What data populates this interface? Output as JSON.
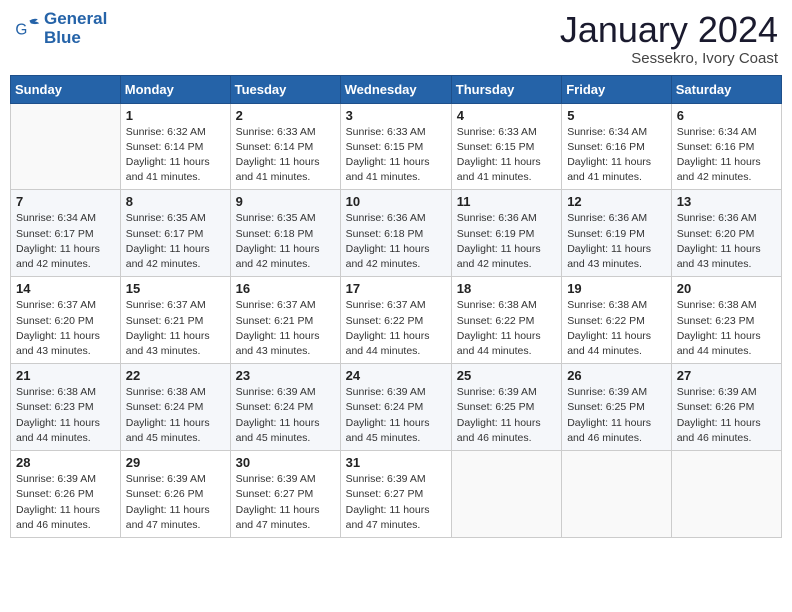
{
  "header": {
    "logo_text_general": "General",
    "logo_text_blue": "Blue",
    "month": "January 2024",
    "location": "Sessekro, Ivory Coast"
  },
  "weekdays": [
    "Sunday",
    "Monday",
    "Tuesday",
    "Wednesday",
    "Thursday",
    "Friday",
    "Saturday"
  ],
  "weeks": [
    [
      {
        "day": "",
        "sunrise": "",
        "sunset": "",
        "daylight": ""
      },
      {
        "day": "1",
        "sunrise": "6:32 AM",
        "sunset": "6:14 PM",
        "daylight": "11 hours and 41 minutes."
      },
      {
        "day": "2",
        "sunrise": "6:33 AM",
        "sunset": "6:14 PM",
        "daylight": "11 hours and 41 minutes."
      },
      {
        "day": "3",
        "sunrise": "6:33 AM",
        "sunset": "6:15 PM",
        "daylight": "11 hours and 41 minutes."
      },
      {
        "day": "4",
        "sunrise": "6:33 AM",
        "sunset": "6:15 PM",
        "daylight": "11 hours and 41 minutes."
      },
      {
        "day": "5",
        "sunrise": "6:34 AM",
        "sunset": "6:16 PM",
        "daylight": "11 hours and 41 minutes."
      },
      {
        "day": "6",
        "sunrise": "6:34 AM",
        "sunset": "6:16 PM",
        "daylight": "11 hours and 42 minutes."
      }
    ],
    [
      {
        "day": "7",
        "sunrise": "6:34 AM",
        "sunset": "6:17 PM",
        "daylight": "11 hours and 42 minutes."
      },
      {
        "day": "8",
        "sunrise": "6:35 AM",
        "sunset": "6:17 PM",
        "daylight": "11 hours and 42 minutes."
      },
      {
        "day": "9",
        "sunrise": "6:35 AM",
        "sunset": "6:18 PM",
        "daylight": "11 hours and 42 minutes."
      },
      {
        "day": "10",
        "sunrise": "6:36 AM",
        "sunset": "6:18 PM",
        "daylight": "11 hours and 42 minutes."
      },
      {
        "day": "11",
        "sunrise": "6:36 AM",
        "sunset": "6:19 PM",
        "daylight": "11 hours and 42 minutes."
      },
      {
        "day": "12",
        "sunrise": "6:36 AM",
        "sunset": "6:19 PM",
        "daylight": "11 hours and 43 minutes."
      },
      {
        "day": "13",
        "sunrise": "6:36 AM",
        "sunset": "6:20 PM",
        "daylight": "11 hours and 43 minutes."
      }
    ],
    [
      {
        "day": "14",
        "sunrise": "6:37 AM",
        "sunset": "6:20 PM",
        "daylight": "11 hours and 43 minutes."
      },
      {
        "day": "15",
        "sunrise": "6:37 AM",
        "sunset": "6:21 PM",
        "daylight": "11 hours and 43 minutes."
      },
      {
        "day": "16",
        "sunrise": "6:37 AM",
        "sunset": "6:21 PM",
        "daylight": "11 hours and 43 minutes."
      },
      {
        "day": "17",
        "sunrise": "6:37 AM",
        "sunset": "6:22 PM",
        "daylight": "11 hours and 44 minutes."
      },
      {
        "day": "18",
        "sunrise": "6:38 AM",
        "sunset": "6:22 PM",
        "daylight": "11 hours and 44 minutes."
      },
      {
        "day": "19",
        "sunrise": "6:38 AM",
        "sunset": "6:22 PM",
        "daylight": "11 hours and 44 minutes."
      },
      {
        "day": "20",
        "sunrise": "6:38 AM",
        "sunset": "6:23 PM",
        "daylight": "11 hours and 44 minutes."
      }
    ],
    [
      {
        "day": "21",
        "sunrise": "6:38 AM",
        "sunset": "6:23 PM",
        "daylight": "11 hours and 44 minutes."
      },
      {
        "day": "22",
        "sunrise": "6:38 AM",
        "sunset": "6:24 PM",
        "daylight": "11 hours and 45 minutes."
      },
      {
        "day": "23",
        "sunrise": "6:39 AM",
        "sunset": "6:24 PM",
        "daylight": "11 hours and 45 minutes."
      },
      {
        "day": "24",
        "sunrise": "6:39 AM",
        "sunset": "6:24 PM",
        "daylight": "11 hours and 45 minutes."
      },
      {
        "day": "25",
        "sunrise": "6:39 AM",
        "sunset": "6:25 PM",
        "daylight": "11 hours and 46 minutes."
      },
      {
        "day": "26",
        "sunrise": "6:39 AM",
        "sunset": "6:25 PM",
        "daylight": "11 hours and 46 minutes."
      },
      {
        "day": "27",
        "sunrise": "6:39 AM",
        "sunset": "6:26 PM",
        "daylight": "11 hours and 46 minutes."
      }
    ],
    [
      {
        "day": "28",
        "sunrise": "6:39 AM",
        "sunset": "6:26 PM",
        "daylight": "11 hours and 46 minutes."
      },
      {
        "day": "29",
        "sunrise": "6:39 AM",
        "sunset": "6:26 PM",
        "daylight": "11 hours and 47 minutes."
      },
      {
        "day": "30",
        "sunrise": "6:39 AM",
        "sunset": "6:27 PM",
        "daylight": "11 hours and 47 minutes."
      },
      {
        "day": "31",
        "sunrise": "6:39 AM",
        "sunset": "6:27 PM",
        "daylight": "11 hours and 47 minutes."
      },
      {
        "day": "",
        "sunrise": "",
        "sunset": "",
        "daylight": ""
      },
      {
        "day": "",
        "sunrise": "",
        "sunset": "",
        "daylight": ""
      },
      {
        "day": "",
        "sunrise": "",
        "sunset": "",
        "daylight": ""
      }
    ]
  ],
  "labels": {
    "sunrise": "Sunrise:",
    "sunset": "Sunset:",
    "daylight": "Daylight:"
  }
}
